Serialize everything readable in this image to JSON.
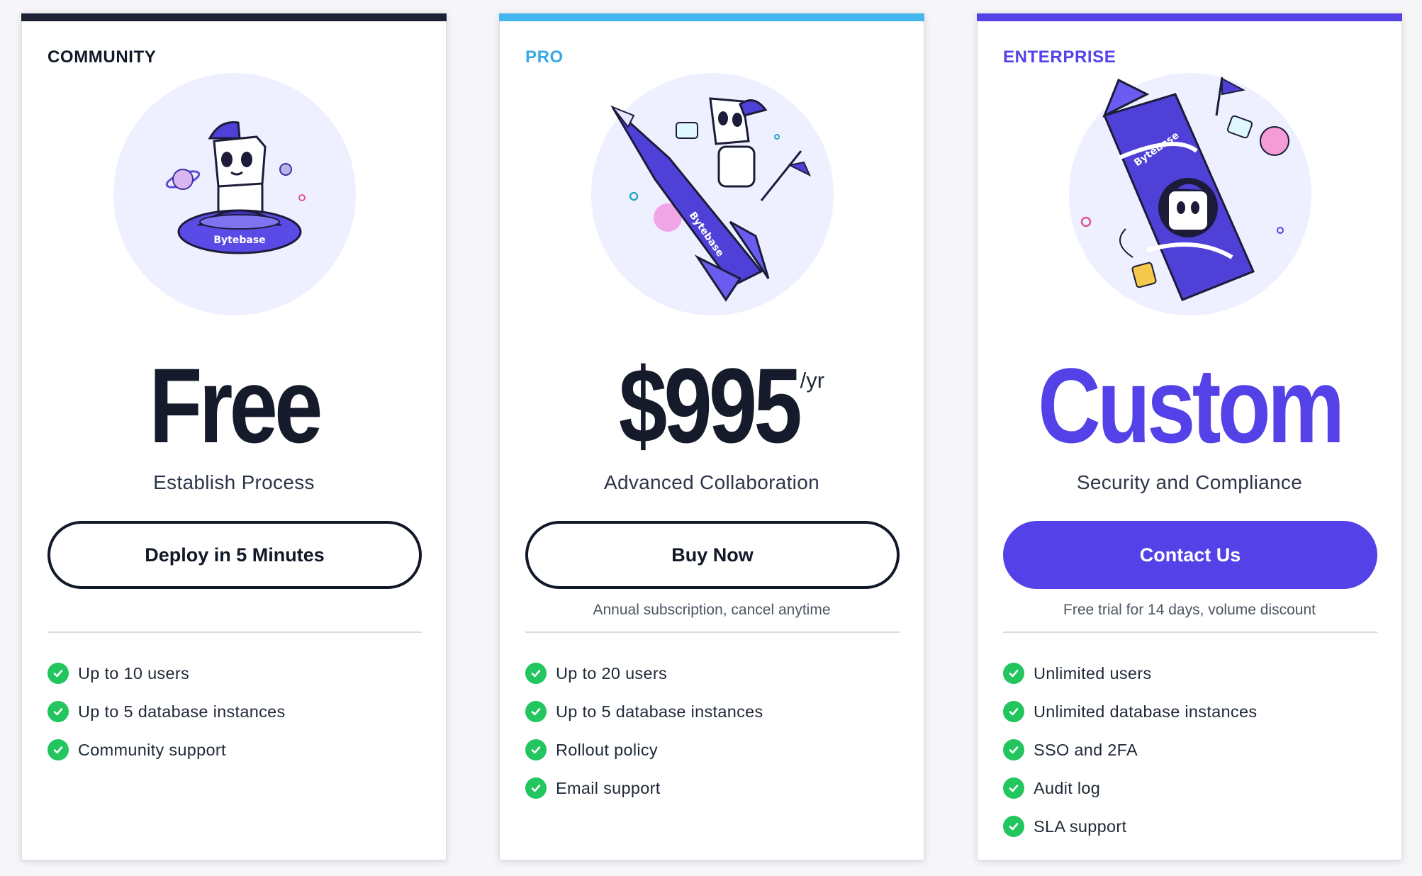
{
  "plans": [
    {
      "tier": "COMMUNITY",
      "price": "Free",
      "period": "",
      "tagline": "Establish Process",
      "cta": "Deploy in 5 Minutes",
      "note": "",
      "features": [
        "Up to 10 users",
        "Up to 5 database instances",
        "Community support"
      ]
    },
    {
      "tier": "PRO",
      "price": "$995",
      "period": "/yr",
      "tagline": "Advanced Collaboration",
      "cta": "Buy Now",
      "note": "Annual subscription, cancel anytime",
      "features": [
        "Up to 20 users",
        "Up to 5 database instances",
        "Rollout policy",
        "Email support"
      ]
    },
    {
      "tier": "ENTERPRISE",
      "price": "Custom",
      "period": "",
      "tagline": "Security and Compliance",
      "cta": "Contact Us",
      "note": "Free trial for 14 days, volume discount",
      "features": [
        "Unlimited users",
        "Unlimited database instances",
        "SSO and 2FA",
        "Audit log",
        "SLA support"
      ]
    }
  ],
  "illustrations": {
    "brand_text": "Bytebase",
    "community": "ufo-mascot-illustration",
    "pro": "rocket-mascot-illustration",
    "enterprise": "capsule-mascot-illustration"
  },
  "icons": {
    "feature": "check-circle-icon"
  },
  "colors": {
    "community_bar": "#1c2233",
    "pro_bar": "#44b6f0",
    "enterprise_bar": "#5442e8",
    "pro_tier": "#3aa8e6",
    "enterprise_accent": "#5442e8",
    "dark": "#161b2c",
    "check": "#22c55e",
    "illus_bg": "#eef0ff"
  }
}
